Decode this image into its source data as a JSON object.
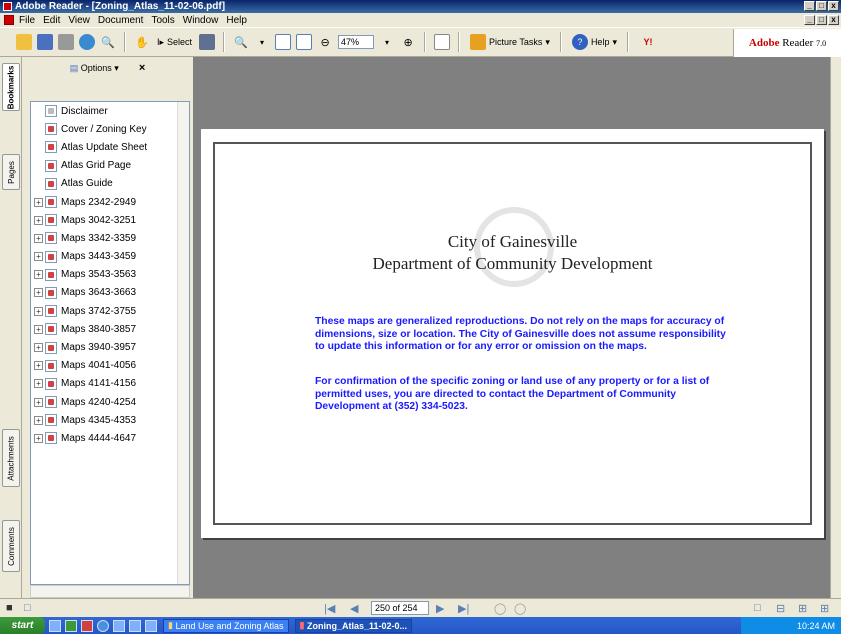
{
  "window": {
    "title": "Adobe Reader - [Zoning_Atlas_11-02-06.pdf]"
  },
  "menubar": {
    "items": [
      "File",
      "Edit",
      "View",
      "Document",
      "Tools",
      "Window",
      "Help"
    ]
  },
  "toolbar": {
    "select_label": "Select",
    "zoom_value": "47%",
    "picture_tasks_label": "Picture Tasks",
    "help_label": "Help",
    "brand": {
      "adobe": "Adobe",
      "reader": "Reader",
      "version": "7.0"
    }
  },
  "side_tabs": {
    "bookmarks": "Bookmarks",
    "pages": "Pages",
    "attachments": "Attachments",
    "comments": "Comments"
  },
  "bookmarks_panel": {
    "options_label": "Options",
    "items": [
      {
        "label": "Disclaimer",
        "expandable": false
      },
      {
        "label": "Cover / Zoning Key",
        "expandable": false
      },
      {
        "label": "Atlas Update Sheet",
        "expandable": false
      },
      {
        "label": "Atlas Grid Page",
        "expandable": false
      },
      {
        "label": "Atlas Guide",
        "expandable": false
      },
      {
        "label": "Maps 2342-2949",
        "expandable": true
      },
      {
        "label": "Maps 3042-3251",
        "expandable": true
      },
      {
        "label": "Maps 3342-3359",
        "expandable": true
      },
      {
        "label": "Maps 3443-3459",
        "expandable": true
      },
      {
        "label": "Maps 3543-3563",
        "expandable": true
      },
      {
        "label": "Maps 3643-3663",
        "expandable": true
      },
      {
        "label": "Maps 3742-3755",
        "expandable": true
      },
      {
        "label": "Maps 3840-3857",
        "expandable": true
      },
      {
        "label": "Maps 3940-3957",
        "expandable": true
      },
      {
        "label": "Maps 4041-4056",
        "expandable": true
      },
      {
        "label": "Maps 4141-4156",
        "expandable": true
      },
      {
        "label": "Maps 4240-4254",
        "expandable": true
      },
      {
        "label": "Maps 4345-4353",
        "expandable": true
      },
      {
        "label": "Maps 4444-4647",
        "expandable": true
      }
    ]
  },
  "document": {
    "title_line1": "City of Gainesville",
    "title_line2": "Department of Community Development",
    "notice_p1": "These maps are generalized reproductions. Do not rely on the maps for accuracy of dimensions, size or location. The City of Gainesville does not assume responsibility to update this information or for any error or omission on the maps.",
    "notice_p2": "For confirmation of the specific zoning or land use of any property or for a list of permitted uses, you are directed to contact the Department of Community Development at (352) 334-5023."
  },
  "navigation": {
    "page_indicator": "250 of 254"
  },
  "taskbar": {
    "start_label": "start",
    "tasks": [
      "Land Use and Zoning Atlas",
      "Zoning_Atlas_11-02-0..."
    ],
    "clock": "10:24 AM"
  }
}
